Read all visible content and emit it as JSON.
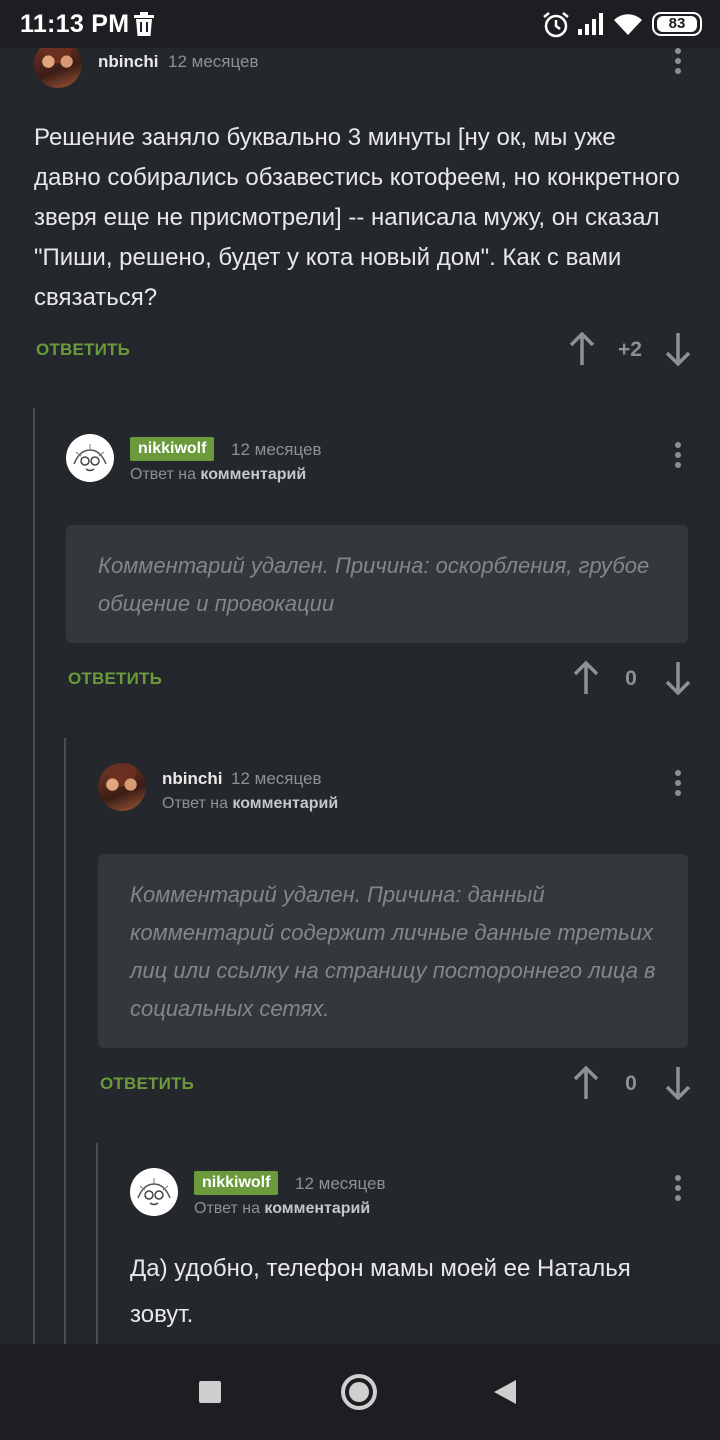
{
  "status_bar": {
    "time": "11:13 PM",
    "battery": "83",
    "icons": [
      "trash-icon",
      "alarm-icon",
      "signal-icon",
      "wifi-icon",
      "battery-icon"
    ]
  },
  "comments": [
    {
      "username": "nbinchi",
      "time": "12 месяцев",
      "body": "Решение заняло буквально 3 минуты [ну ок, мы уже давно собирались обзавестись котофеем, но конкретного зверя еще не присмотрели] -- написала мужу, он сказал \"Пиши, решено, будет у кота новый дом\". Как с вами связаться?",
      "reply_label": "ОТВЕТИТЬ",
      "score": "+2"
    },
    {
      "username": "nikkiwolf",
      "time": "12 месяцев",
      "reply_prefix": "Ответ на",
      "reply_target": "комментарий",
      "deleted_text": "Комментарий удален. Причина: оскорбления, грубое общение и провокации",
      "reply_label": "ОТВЕТИТЬ",
      "score": "0"
    },
    {
      "username": "nbinchi",
      "time": "12 месяцев",
      "reply_prefix": "Ответ на",
      "reply_target": "комментарий",
      "deleted_text": "Комментарий удален. Причина: данный комментарий содержит личные данные третьих лиц или ссылку на страницу постороннего лица в социальных сетях.",
      "reply_label": "ОТВЕТИТЬ",
      "score": "0"
    },
    {
      "username": "nikkiwolf",
      "time": "12 месяцев",
      "reply_prefix": "Ответ на",
      "reply_target": "комментарий",
      "body": "Да) удобно, телефон мамы моей ее Наталья зовут."
    }
  ],
  "colors": {
    "background": "#24272b",
    "accent_green": "#6a9a3c",
    "muted": "#8d9096"
  }
}
